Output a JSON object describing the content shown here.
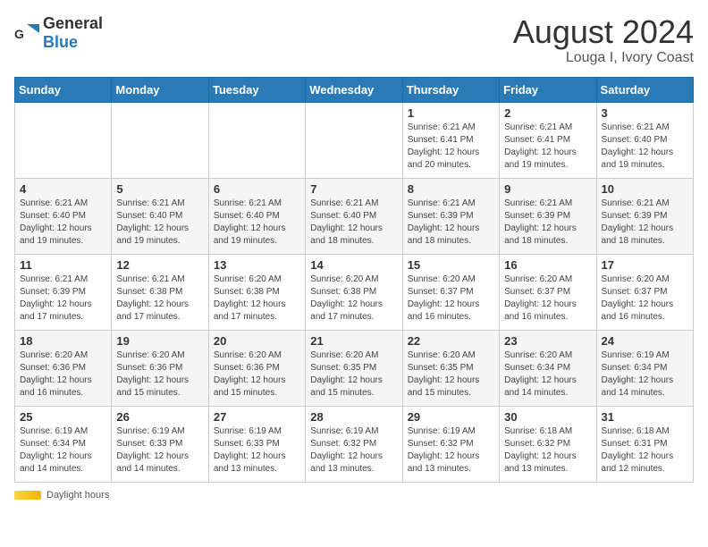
{
  "header": {
    "logo_general": "General",
    "logo_blue": "Blue",
    "main_title": "August 2024",
    "sub_title": "Louga I, Ivory Coast"
  },
  "days_of_week": [
    "Sunday",
    "Monday",
    "Tuesday",
    "Wednesday",
    "Thursday",
    "Friday",
    "Saturday"
  ],
  "weeks": [
    [
      {
        "day": "",
        "info": ""
      },
      {
        "day": "",
        "info": ""
      },
      {
        "day": "",
        "info": ""
      },
      {
        "day": "",
        "info": ""
      },
      {
        "day": "1",
        "info": "Sunrise: 6:21 AM\nSunset: 6:41 PM\nDaylight: 12 hours and 20 minutes."
      },
      {
        "day": "2",
        "info": "Sunrise: 6:21 AM\nSunset: 6:41 PM\nDaylight: 12 hours and 19 minutes."
      },
      {
        "day": "3",
        "info": "Sunrise: 6:21 AM\nSunset: 6:40 PM\nDaylight: 12 hours and 19 minutes."
      }
    ],
    [
      {
        "day": "4",
        "info": "Sunrise: 6:21 AM\nSunset: 6:40 PM\nDaylight: 12 hours and 19 minutes."
      },
      {
        "day": "5",
        "info": "Sunrise: 6:21 AM\nSunset: 6:40 PM\nDaylight: 12 hours and 19 minutes."
      },
      {
        "day": "6",
        "info": "Sunrise: 6:21 AM\nSunset: 6:40 PM\nDaylight: 12 hours and 19 minutes."
      },
      {
        "day": "7",
        "info": "Sunrise: 6:21 AM\nSunset: 6:40 PM\nDaylight: 12 hours and 18 minutes."
      },
      {
        "day": "8",
        "info": "Sunrise: 6:21 AM\nSunset: 6:39 PM\nDaylight: 12 hours and 18 minutes."
      },
      {
        "day": "9",
        "info": "Sunrise: 6:21 AM\nSunset: 6:39 PM\nDaylight: 12 hours and 18 minutes."
      },
      {
        "day": "10",
        "info": "Sunrise: 6:21 AM\nSunset: 6:39 PM\nDaylight: 12 hours and 18 minutes."
      }
    ],
    [
      {
        "day": "11",
        "info": "Sunrise: 6:21 AM\nSunset: 6:39 PM\nDaylight: 12 hours and 17 minutes."
      },
      {
        "day": "12",
        "info": "Sunrise: 6:21 AM\nSunset: 6:38 PM\nDaylight: 12 hours and 17 minutes."
      },
      {
        "day": "13",
        "info": "Sunrise: 6:20 AM\nSunset: 6:38 PM\nDaylight: 12 hours and 17 minutes."
      },
      {
        "day": "14",
        "info": "Sunrise: 6:20 AM\nSunset: 6:38 PM\nDaylight: 12 hours and 17 minutes."
      },
      {
        "day": "15",
        "info": "Sunrise: 6:20 AM\nSunset: 6:37 PM\nDaylight: 12 hours and 16 minutes."
      },
      {
        "day": "16",
        "info": "Sunrise: 6:20 AM\nSunset: 6:37 PM\nDaylight: 12 hours and 16 minutes."
      },
      {
        "day": "17",
        "info": "Sunrise: 6:20 AM\nSunset: 6:37 PM\nDaylight: 12 hours and 16 minutes."
      }
    ],
    [
      {
        "day": "18",
        "info": "Sunrise: 6:20 AM\nSunset: 6:36 PM\nDaylight: 12 hours and 16 minutes."
      },
      {
        "day": "19",
        "info": "Sunrise: 6:20 AM\nSunset: 6:36 PM\nDaylight: 12 hours and 15 minutes."
      },
      {
        "day": "20",
        "info": "Sunrise: 6:20 AM\nSunset: 6:36 PM\nDaylight: 12 hours and 15 minutes."
      },
      {
        "day": "21",
        "info": "Sunrise: 6:20 AM\nSunset: 6:35 PM\nDaylight: 12 hours and 15 minutes."
      },
      {
        "day": "22",
        "info": "Sunrise: 6:20 AM\nSunset: 6:35 PM\nDaylight: 12 hours and 15 minutes."
      },
      {
        "day": "23",
        "info": "Sunrise: 6:20 AM\nSunset: 6:34 PM\nDaylight: 12 hours and 14 minutes."
      },
      {
        "day": "24",
        "info": "Sunrise: 6:19 AM\nSunset: 6:34 PM\nDaylight: 12 hours and 14 minutes."
      }
    ],
    [
      {
        "day": "25",
        "info": "Sunrise: 6:19 AM\nSunset: 6:34 PM\nDaylight: 12 hours and 14 minutes."
      },
      {
        "day": "26",
        "info": "Sunrise: 6:19 AM\nSunset: 6:33 PM\nDaylight: 12 hours and 14 minutes."
      },
      {
        "day": "27",
        "info": "Sunrise: 6:19 AM\nSunset: 6:33 PM\nDaylight: 12 hours and 13 minutes."
      },
      {
        "day": "28",
        "info": "Sunrise: 6:19 AM\nSunset: 6:32 PM\nDaylight: 12 hours and 13 minutes."
      },
      {
        "day": "29",
        "info": "Sunrise: 6:19 AM\nSunset: 6:32 PM\nDaylight: 12 hours and 13 minutes."
      },
      {
        "day": "30",
        "info": "Sunrise: 6:18 AM\nSunset: 6:32 PM\nDaylight: 12 hours and 13 minutes."
      },
      {
        "day": "31",
        "info": "Sunrise: 6:18 AM\nSunset: 6:31 PM\nDaylight: 12 hours and 12 minutes."
      }
    ]
  ],
  "footer": {
    "daylight_label": "Daylight hours"
  }
}
